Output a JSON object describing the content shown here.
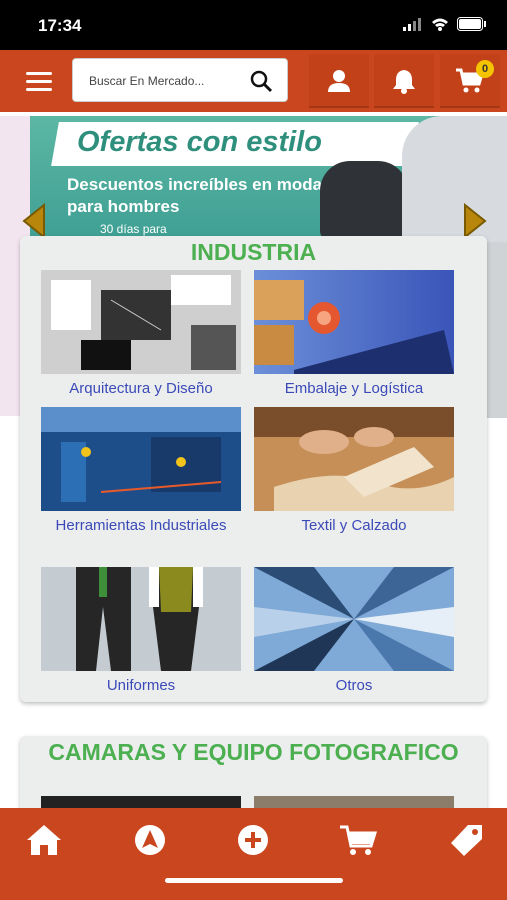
{
  "status_bar": {
    "time": "17:34"
  },
  "header": {
    "search_placeholder": "Buscar En Mercado...",
    "cart_count": "0"
  },
  "banner": {
    "title": "Ofertas con estilo",
    "subtitle": "Descuentos increíbles en moda para hombres",
    "small_text": "30 días para"
  },
  "industria": {
    "title": "INDUSTRIA",
    "items": [
      {
        "label": "Arquitectura y Diseño"
      },
      {
        "label": "Embalaje y Logística"
      },
      {
        "label": "Herramientas Industriales"
      },
      {
        "label": "Textil y Calzado"
      },
      {
        "label": "Uniformes"
      },
      {
        "label": "Otros"
      }
    ]
  },
  "camaras": {
    "title": "CAMARAS Y EQUIPO FOTOGRAFICO"
  },
  "colors": {
    "brand": "#c9461f",
    "section_title": "#4caf50",
    "link": "#3b4ab8",
    "badge": "#f5c400"
  },
  "bottom_nav": [
    "home-icon",
    "navigate-icon",
    "add-icon",
    "cart-icon",
    "tag-icon"
  ]
}
